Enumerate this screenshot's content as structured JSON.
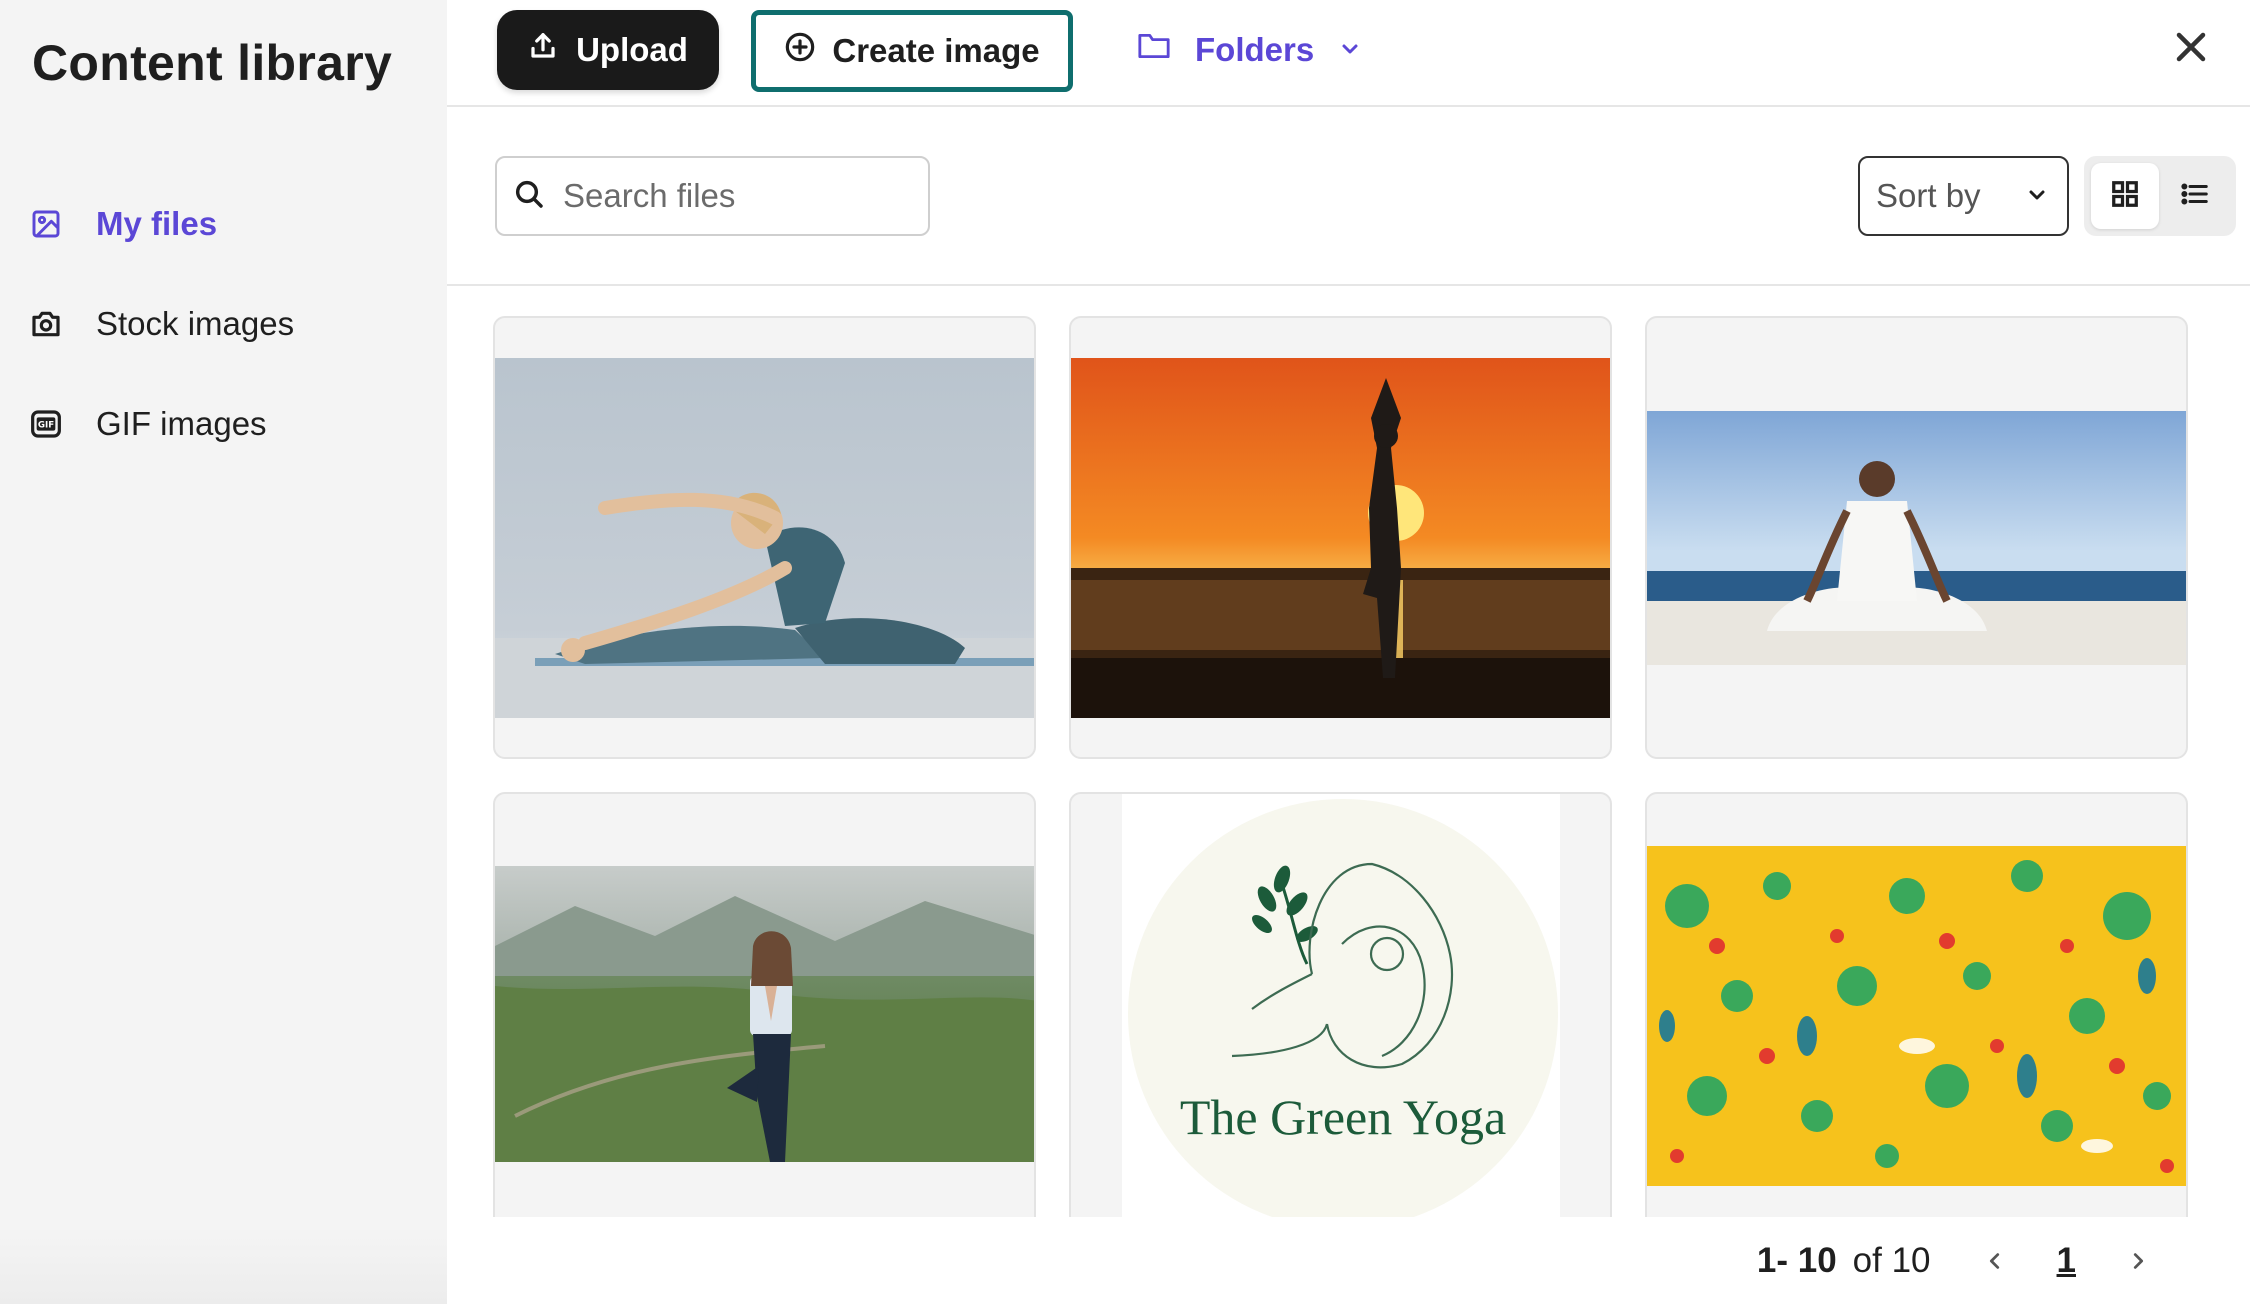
{
  "sidebar": {
    "title": "Content library",
    "items": [
      {
        "label": "My files",
        "icon": "image-icon",
        "active": true
      },
      {
        "label": "Stock images",
        "icon": "camera-icon",
        "active": false
      },
      {
        "label": "GIF images",
        "icon": "gif-icon",
        "active": false
      }
    ]
  },
  "topbar": {
    "upload_label": "Upload",
    "create_label": "Create image",
    "folders_label": "Folders"
  },
  "toolbar": {
    "search_placeholder": "Search files",
    "sort_label": "Sort by",
    "view_mode": "grid"
  },
  "gallery": {
    "items": [
      {
        "name": "woman-stretching-on-mat"
      },
      {
        "name": "tree-pose-sunset-lake"
      },
      {
        "name": "meditation-on-beach"
      },
      {
        "name": "tree-pose-in-meadow"
      },
      {
        "name": "the-green-yoga-logo",
        "logo_text": "The Green Yoga"
      },
      {
        "name": "desert-cactus-pattern"
      }
    ]
  },
  "pagination": {
    "range": "1- 10",
    "total": "of 10",
    "current_page": "1"
  },
  "colors": {
    "accent": "#5b47d6",
    "create_border": "#0f6e6e",
    "upload_bg": "#1a1a1a",
    "sidebar_bg": "#f4f4f4"
  }
}
